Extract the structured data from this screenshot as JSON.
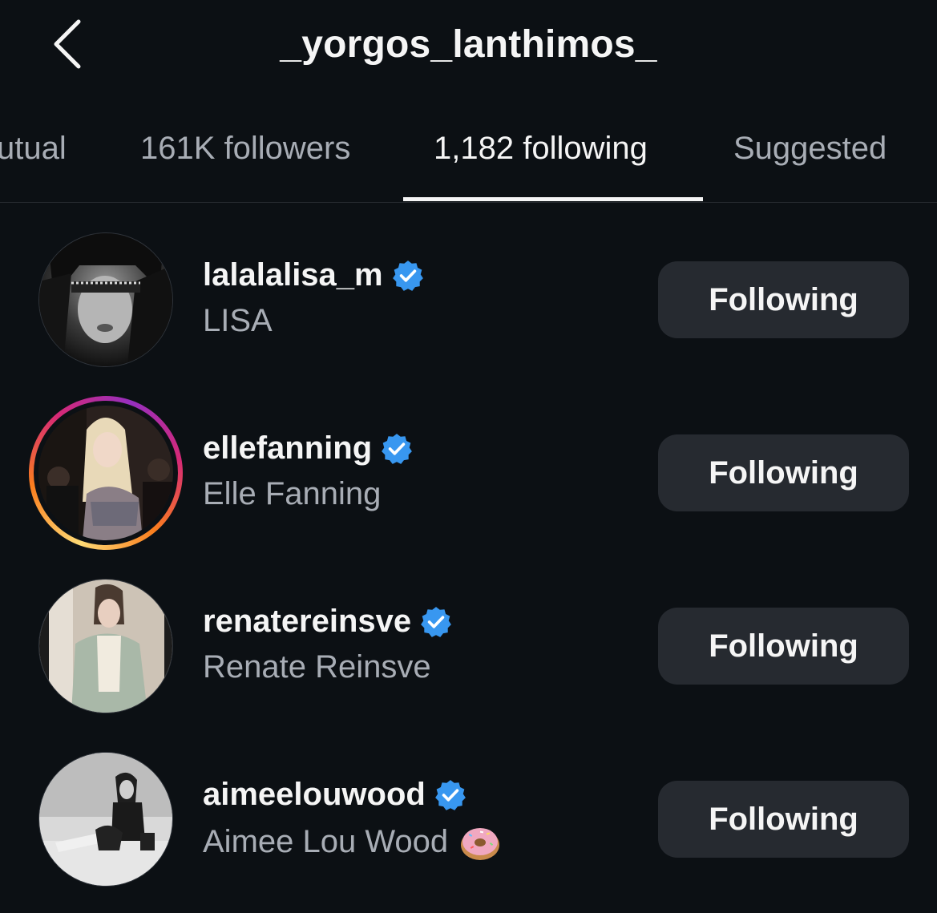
{
  "header": {
    "title": "_yorgos_lanthimos_",
    "back_icon": "chevron-left-icon"
  },
  "tabs": [
    {
      "label": "utual",
      "active": false
    },
    {
      "label": "161K followers",
      "active": false
    },
    {
      "label": "1,182 following",
      "active": true
    },
    {
      "label": "Suggested",
      "active": false
    }
  ],
  "colors": {
    "background": "#0c1014",
    "button_bg": "#262a30",
    "verified_blue": "#3897f0",
    "secondary_text": "#a8adb5",
    "primary_text": "#f5f5f5"
  },
  "list": [
    {
      "username": "lalalalisa_m",
      "full_name": "LISA",
      "verified": true,
      "button": "Following",
      "has_story": false
    },
    {
      "username": "ellefanning",
      "full_name": "Elle Fanning",
      "verified": true,
      "button": "Following",
      "has_story": true
    },
    {
      "username": "renatereinsve",
      "full_name": "Renate Reinsve",
      "verified": true,
      "button": "Following",
      "has_story": false
    },
    {
      "username": "aimeelouwood",
      "full_name": "Aimee Lou Wood",
      "verified": true,
      "button": "Following",
      "has_story": false,
      "name_emoji": "donut-icon"
    }
  ]
}
